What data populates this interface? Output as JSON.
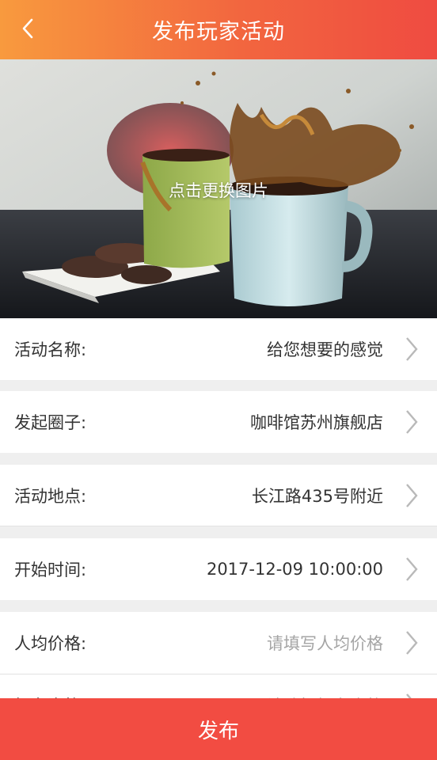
{
  "header": {
    "title": "发布玩家活动",
    "back_icon": "chevron-left-icon"
  },
  "cover": {
    "caption": "点击更换图片"
  },
  "form": {
    "rows": [
      {
        "label": "活动名称:",
        "value": "给您想要的感觉",
        "is_placeholder": false
      },
      {
        "label": "发起圈子:",
        "value": "咖啡馆苏州旗舰店",
        "is_placeholder": false
      },
      {
        "label": "活动地点:",
        "value": "长江路435号附近",
        "is_placeholder": false
      },
      {
        "label": "开始时间:",
        "value": "2017-12-09 10:00:00",
        "is_placeholder": false
      },
      {
        "label": "人均价格:",
        "value": "请填写人均价格",
        "is_placeholder": true
      },
      {
        "label": "报名资格:",
        "value": "请选择报名资格",
        "is_placeholder": true
      }
    ]
  },
  "footer": {
    "publish_label": "发布"
  },
  "colors": {
    "accent": "#f24c42",
    "header_start": "#f89a3e",
    "header_end": "#ef4b41"
  }
}
